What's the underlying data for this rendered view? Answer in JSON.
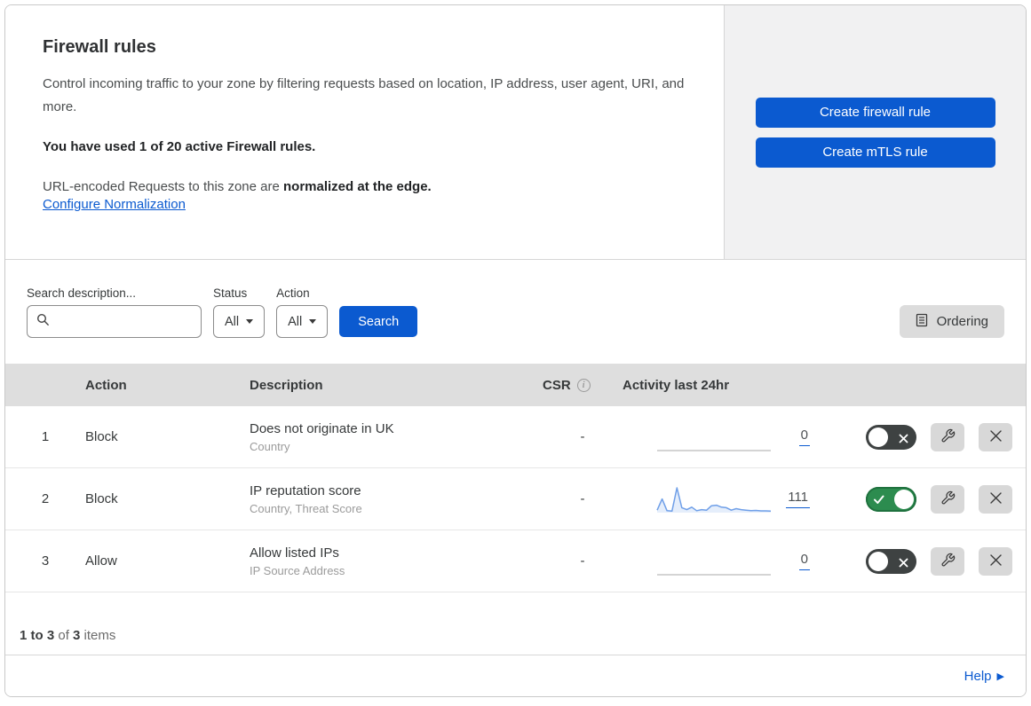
{
  "header": {
    "title": "Firewall rules",
    "description": "Control incoming traffic to your zone by filtering requests based on location, IP address, user agent, URI, and more.",
    "usage": "You have used 1 of 20 active Firewall rules.",
    "normalization_prefix": "URL-encoded Requests to this zone are ",
    "normalization_bold": "normalized at the edge.",
    "normalization_link": "Configure Normalization",
    "create_firewall_button": "Create firewall rule",
    "create_mtls_button": "Create mTLS rule"
  },
  "filters": {
    "search_label": "Search description...",
    "search_placeholder": "",
    "status_label": "Status",
    "status_value": "All",
    "action_label": "Action",
    "action_value": "All",
    "search_button": "Search",
    "ordering_button": "Ordering"
  },
  "table": {
    "columns": {
      "action": "Action",
      "description": "Description",
      "csr": "CSR",
      "activity": "Activity last 24hr"
    },
    "rows": [
      {
        "priority": "1",
        "action": "Block",
        "description": "Does not originate in UK",
        "fields": "Country",
        "csr": "-",
        "activity_count": "0",
        "enabled": false,
        "sparkline": {
          "points": [
            0,
            0
          ],
          "color": "#c6c6c6",
          "fill": null
        }
      },
      {
        "priority": "2",
        "action": "Block",
        "description": "IP reputation score",
        "fields": "Country, Threat Score",
        "csr": "-",
        "activity_count": "111",
        "enabled": true,
        "sparkline": {
          "points": [
            10,
            55,
            8,
            6,
            100,
            20,
            12,
            22,
            8,
            12,
            10,
            28,
            30,
            22,
            20,
            10,
            16,
            12,
            10,
            8,
            9,
            7,
            7,
            6
          ],
          "color": "#6f9fe8",
          "fill": "rgba(111,159,232,0.18)"
        }
      },
      {
        "priority": "3",
        "action": "Allow",
        "description": "Allow listed IPs",
        "fields": "IP Source Address",
        "csr": "-",
        "activity_count": "0",
        "enabled": false,
        "sparkline": {
          "points": [
            0,
            0
          ],
          "color": "#c6c6c6",
          "fill": null
        }
      }
    ]
  },
  "footer": {
    "range": "1 to 3",
    "of_text": " of ",
    "total": "3",
    "items_text": " items",
    "help": "Help"
  },
  "colors": {
    "primary_blue": "#0b5ad0",
    "toggle_on_green": "#2c8c4f",
    "toggle_off_gray": "#3e4242",
    "sparkline_blue": "#6f9fe8"
  }
}
